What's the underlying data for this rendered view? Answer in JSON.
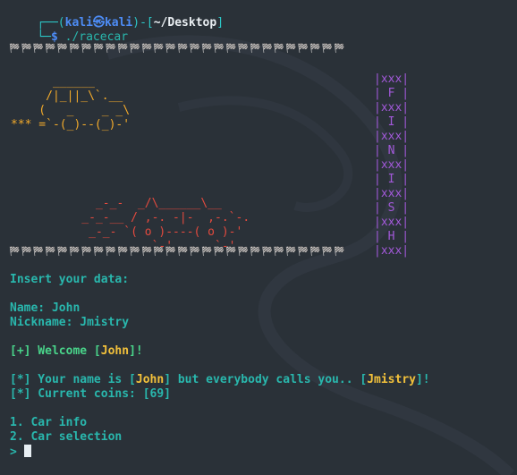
{
  "prompt": {
    "user": "kali",
    "host": "kali",
    "dir": "~/Desktop",
    "command": "./racecar"
  },
  "flag_row": "🏁🏁🏁🏁🏁🏁🏁🏁🏁🏁🏁🏁🏁🏁🏁🏁🏁🏁🏁🏁🏁🏁🏁🏁🏁🏁🏁🏁",
  "car_top": [
    "      ______",
    "     /|_||_\\`.__",
    "    (   _    _ _\\",
    "*** =`-(_)--(_)-'"
  ],
  "car_red": [
    "      _-_-  _/\\______\\__",
    "    _-_-__ / ,-. -|-  ,-.`-.",
    "     _-_- `( o )----( o )-'",
    "              `-'      `-'"
  ],
  "finish_banner": [
    "|xxx|",
    "| F |",
    "|xxx|",
    "| I |",
    "|xxx|",
    "| N |",
    "|xxx|",
    "| I |",
    "|xxx|",
    "| S |",
    "|xxx|",
    "| H |",
    "|xxx|"
  ],
  "session": {
    "insert_prompt": "Insert your data:",
    "name_label": "Name: John",
    "nickname_label": "Nickname: Jmistry",
    "welcome_prefix": "[+] Welcome [",
    "welcome_name": "John",
    "welcome_suffix": "]!",
    "info1_prefix": "[*] Your name is [",
    "info1_name": "John",
    "info1_mid": "] but everybody calls you.. [",
    "info1_nick": "Jmistry",
    "info1_suffix": "]!",
    "coins_text": "[*] Current coins: [69]",
    "menu_1": "1. Car info",
    "menu_2": "2. Car selection",
    "input_prompt": "> "
  },
  "colors": {
    "background": "#2a3138",
    "prompt_cyan": "#2cc7c7",
    "prompt_blue": "#4d8cf5",
    "car_top": "#f2aa2b",
    "car_red": "#e44a3e",
    "banner": "#a259d9",
    "session_text": "#29b7ad",
    "highlight": "#f2c13b"
  }
}
